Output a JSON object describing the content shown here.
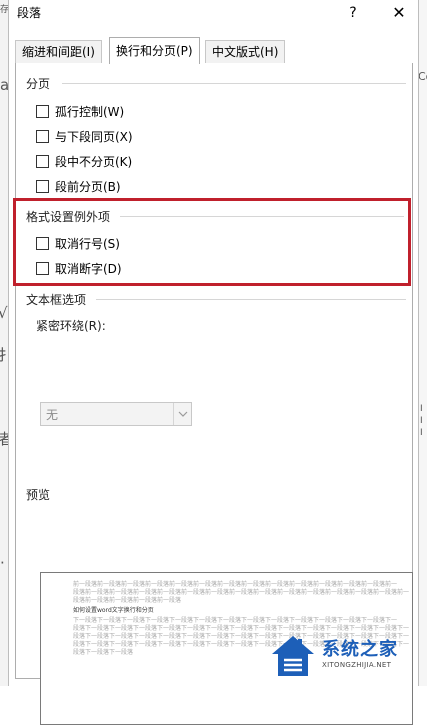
{
  "background": {
    "left_chars": [
      "存",
      "a",
      "√",
      "扌",
      "者",
      "·"
    ],
    "right_chars": [
      "Co",
      "I",
      "I",
      "I"
    ]
  },
  "dialog": {
    "title": "段落",
    "help_label": "?",
    "close_label": "✕"
  },
  "tabs": [
    {
      "label": "缩进和间距(I)"
    },
    {
      "label": "换行和分页(P)"
    },
    {
      "label": "中文版式(H)"
    }
  ],
  "pagination": {
    "title": "分页",
    "options": [
      {
        "label": "孤行控制(W)",
        "checked": false
      },
      {
        "label": "与下段同页(X)",
        "checked": false
      },
      {
        "label": "段中不分页(K)",
        "checked": false
      },
      {
        "label": "段前分页(B)",
        "checked": false
      }
    ]
  },
  "formatting_exceptions": {
    "title": "格式设置例外项",
    "options": [
      {
        "label": "取消行号(S)",
        "checked": false
      },
      {
        "label": "取消断字(D)",
        "checked": false
      }
    ]
  },
  "textbox_options": {
    "title": "文本框选项",
    "tight_wrap_label": "紧密环绕(R):",
    "tight_wrap_value": "无"
  },
  "preview": {
    "title": "预览",
    "lines": [
      "前一段落前一段落前一段落前一段落前一段落前一段落前一段落前一段落前一段落前一段落前一段落前一段落前一段落前一",
      "段落前一段落前一段落前一段落前一段落前一段落前一段落前一段落前一段落前一段落前一段落前一段落前一段落前一段落前一",
      "段落前一段落前一段落前一段落前一段落",
      "如何设置word文字换行和分页",
      "下一段落下一段落下一段落下一段落下一段落下一段落下一段落下一段落下一段落下一段落下一段落下一段落下一段落下一",
      "段落下一段落下一段落下一段落下一段落下一段落下一段落下一段落下一段落下一段落下一段落下一段落下一段落下一段落下一",
      "段落下一段落下一段落下一段落下一段落下一段落下一段落下一段落下一段落下一段落下一段落下一段落下一段落下一段落下一",
      "段落下一段落下一段落下一段落下一段落下一段落下一段落下一段落下一段落下一段落下一段落下一段落下一段落下一段落下一",
      "段落下一段落下一段落"
    ]
  },
  "watermark": {
    "title": "系统之家",
    "subtitle": "XITONGZHIJIA.NET"
  },
  "colors": {
    "highlight": "#c0202c",
    "watermark": "#1d5fb8"
  }
}
